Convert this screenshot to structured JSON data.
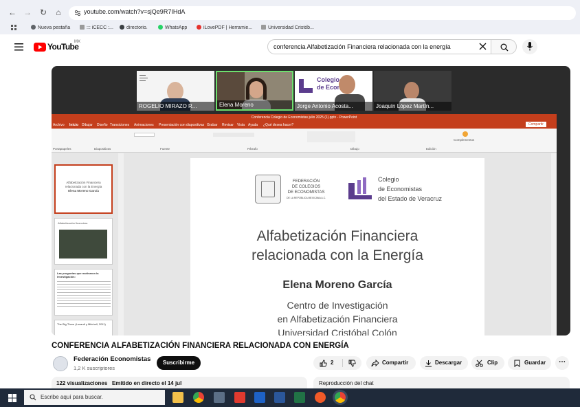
{
  "browser": {
    "url": "youtube.com/watch?v=sjQe9R7IHdA",
    "bookmarks": [
      {
        "label": "Nueva pestaña",
        "color": "#5f6368"
      },
      {
        "label": "::: iCECC :...",
        "color": "#7a7a7a"
      },
      {
        "label": "directorio.",
        "color": "#3c4043"
      },
      {
        "label": "WhatsApp",
        "color": "#25d366"
      },
      {
        "label": "iLovePDF | Herramie...",
        "color": "#e5322d"
      },
      {
        "label": "Universidad Cristób...",
        "color": "#7a7a7a"
      }
    ]
  },
  "youtube": {
    "logo_text": "YouTube",
    "region": "MX",
    "search_value": "conferencia Alfabetización Financiera relacionada con la energía"
  },
  "video": {
    "participants": [
      "ROGELIO MIRAZO R...",
      "Elena Moreno",
      "Jorge Antonio Acosta...",
      "Joaquín López Martín..."
    ],
    "ppt_window_title": "Conferencia Colegio de Economistas julio 2025 (1).pptx  -  PowerPoint",
    "ppt_tabs": [
      "Archivo",
      "Inicio",
      "Dibujar",
      "Diseño",
      "Transiciones",
      "Animaciones",
      "Presentación con diapositivas",
      "Grabar",
      "Revisar",
      "Vista",
      "Ayuda",
      "¿Qué desea hacer?"
    ],
    "ppt_share": "Compartir",
    "ppt_ribbon_groups": [
      "Portapapeles",
      "Diapositivas",
      "Fuente",
      "Párrafo",
      "Dibujo",
      "Edición",
      "Complementos"
    ],
    "slide": {
      "federacion_lines": [
        "FEDERACIÓN",
        "DE COLEGIOS",
        "DE ECONOMISTAS"
      ],
      "federacion_sub": "DE LA REPÚBLICA MEXICANA A.C.",
      "colegio_lines": [
        "Colegio",
        "de Economistas",
        "del Estado de Veracruz"
      ],
      "title_line1": "Alfabetización Financiera",
      "title_line2": "relacionada con la Energía",
      "speaker": "Elena Moreno García",
      "affil_line1": "Centro de Investigación",
      "affil_line2": "en Alfabetización Financiera",
      "affil_line3": "Universidad Cristóbal Colón"
    },
    "thumbs": [
      {
        "t1": "Alfabetización Financiera",
        "t2": "relacionada con la Energía",
        "t3": "Elena Moreno García"
      },
      {
        "t1": "Alfabetización financiera"
      },
      {
        "t1": "Las preguntas que motivaron la investigación:"
      },
      {
        "t1": "The Big Three (Lusardi y Mitchell, 2011)"
      }
    ]
  },
  "details": {
    "title": "CONFERENCIA ALFABETIZACIÓN FINANCIERA RELACIONADA CON ENERGÍA",
    "channel": "Federación Economistas",
    "subscribers": "1,2 K suscriptores",
    "subscribe_label": "Suscribirme",
    "likes": "2",
    "share_label": "Compartir",
    "download_label": "Descargar",
    "clip_label": "Clip",
    "save_label": "Guardar",
    "views": "122 visualizaciones",
    "streamed": "Emitido en directo el 14 jul",
    "chat_label": "Reproducción del chat"
  },
  "taskbar": {
    "search_placeholder": "Escribe aquí para buscar."
  }
}
